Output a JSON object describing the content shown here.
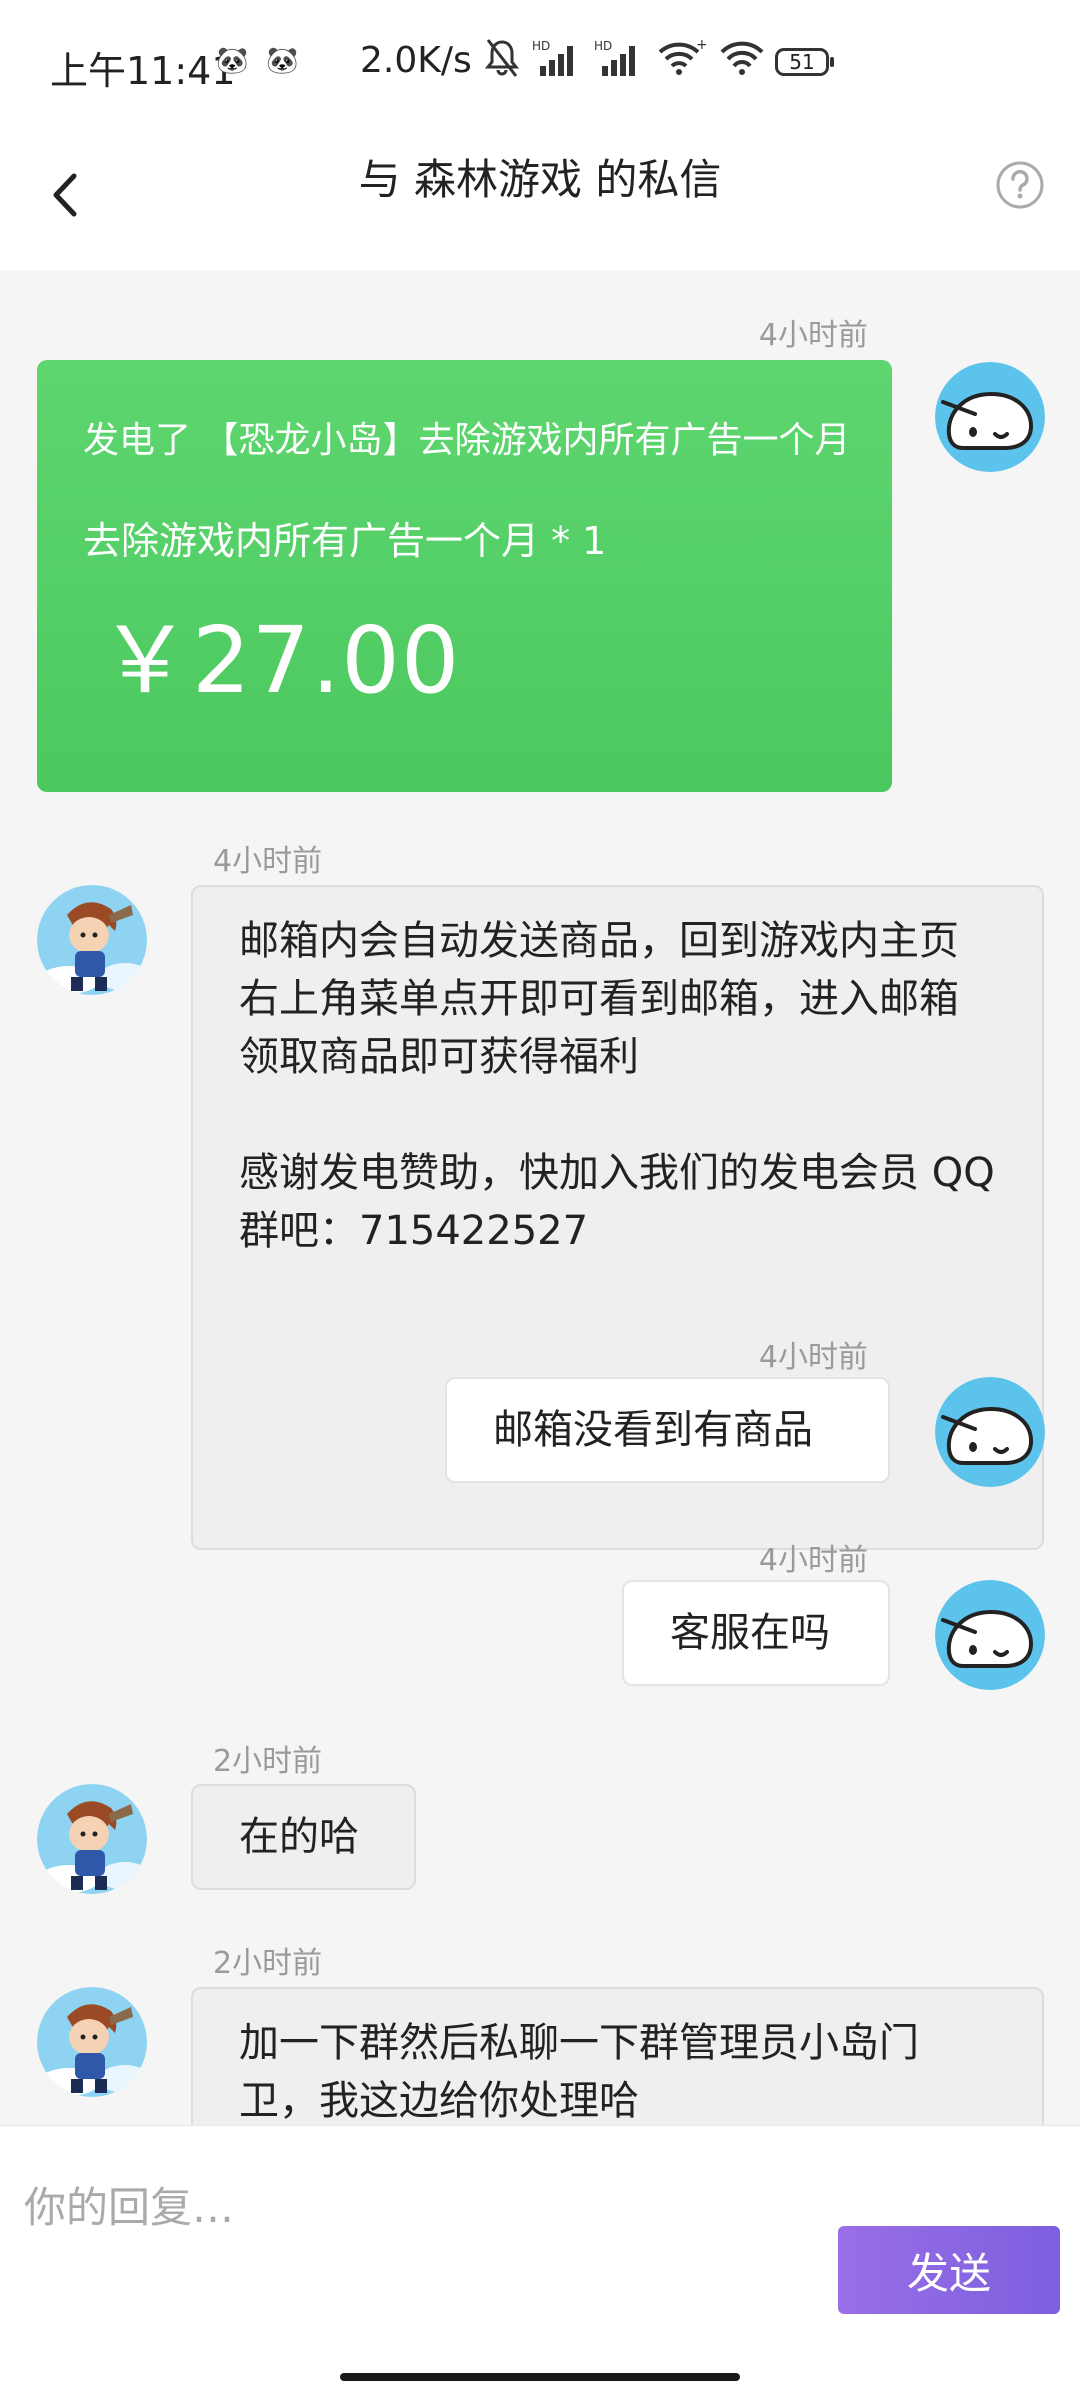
{
  "status": {
    "time": "上午11:41",
    "net_speed": "2.0K/s",
    "battery": "51",
    "icons": [
      "bell-off-icon",
      "signal-hd-icon",
      "signal-hd-icon",
      "wifi-plus-icon",
      "wifi-icon",
      "battery-icon"
    ]
  },
  "header": {
    "title": "与 森林游戏 的私信",
    "back_icon": "chevron-left-icon",
    "help_icon": "help-circle-icon"
  },
  "messages": [
    {
      "id": "order",
      "side": "out",
      "time": "4小时前",
      "card": {
        "product": "发电了 【恐龙小岛】去除游戏内所有广告一个月",
        "quantity": "去除游戏内所有广告一个月 * 1",
        "price": "￥27.00"
      }
    },
    {
      "id": "m1",
      "side": "in",
      "time": "4小时前",
      "text": "邮箱内会自动发送商品，回到游戏内主页右上角菜单点开即可看到邮箱，进入邮箱领取商品即可获得福利\n\n感谢发电赞助，快加入我们的发电会员 QQ 群吧：715422527"
    },
    {
      "id": "m2",
      "side": "out",
      "time": "4小时前",
      "text": "邮箱没看到有商品"
    },
    {
      "id": "m3",
      "side": "out",
      "time": "4小时前",
      "text": "客服在吗"
    },
    {
      "id": "m4",
      "side": "in",
      "time": "2小时前",
      "text": "在的哈"
    },
    {
      "id": "m5",
      "side": "in",
      "time": "2小时前",
      "text": "加一下群然后私聊一下群管理员小岛门卫，我这边给你处理哈"
    }
  ],
  "reply": {
    "placeholder": "你的回复…",
    "send_label": "发送"
  },
  "colors": {
    "order_card": "#52cf66",
    "send_button": "#8a66e3",
    "self_avatar": "#5cc3ec",
    "chat_background": "#f5f5f5"
  }
}
